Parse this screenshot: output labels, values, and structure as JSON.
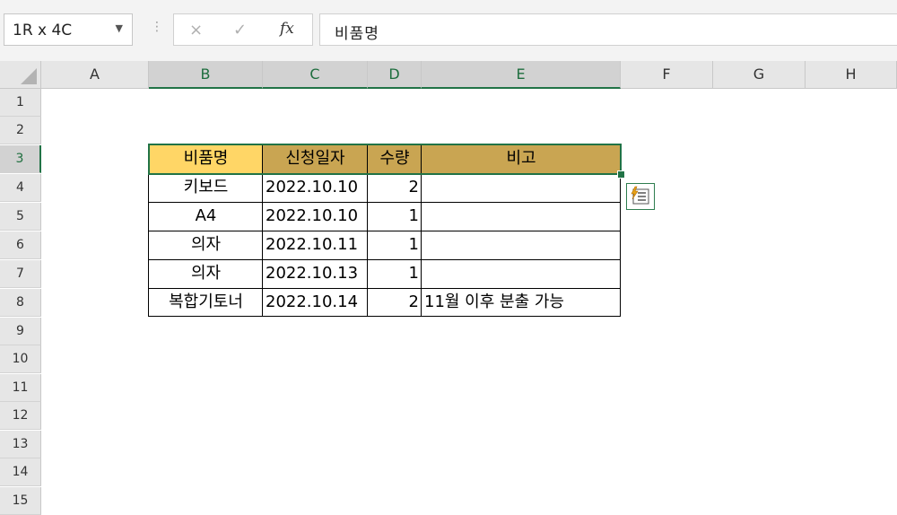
{
  "formula_bar": {
    "name_box": "1R x 4C",
    "cancel_icon": "×",
    "confirm_icon": "✓",
    "fx_label": "fx",
    "formula": "비품명"
  },
  "columns": [
    "A",
    "B",
    "C",
    "D",
    "E",
    "F",
    "G",
    "H"
  ],
  "rows": [
    "1",
    "2",
    "3",
    "4",
    "5",
    "6",
    "7",
    "8",
    "9",
    "10",
    "11",
    "12",
    "13",
    "14",
    "15"
  ],
  "table": {
    "headers": [
      "비품명",
      "신청일자",
      "수량",
      "비고"
    ],
    "rows": [
      [
        "키보드",
        "2022.10.10",
        "2",
        ""
      ],
      [
        "A4",
        "2022.10.10",
        "1",
        ""
      ],
      [
        "의자",
        "2022.10.11",
        "1",
        ""
      ],
      [
        "의자",
        "2022.10.13",
        "1",
        ""
      ],
      [
        "복합기토너",
        "2022.10.14",
        "2",
        "11월 이후 분출 가능"
      ]
    ]
  },
  "colors": {
    "header_fill": "#c9a552",
    "active_header_fill": "#ffd666",
    "selection": "#217346"
  },
  "icons": {
    "quick_analysis": "quick-analysis-icon"
  }
}
